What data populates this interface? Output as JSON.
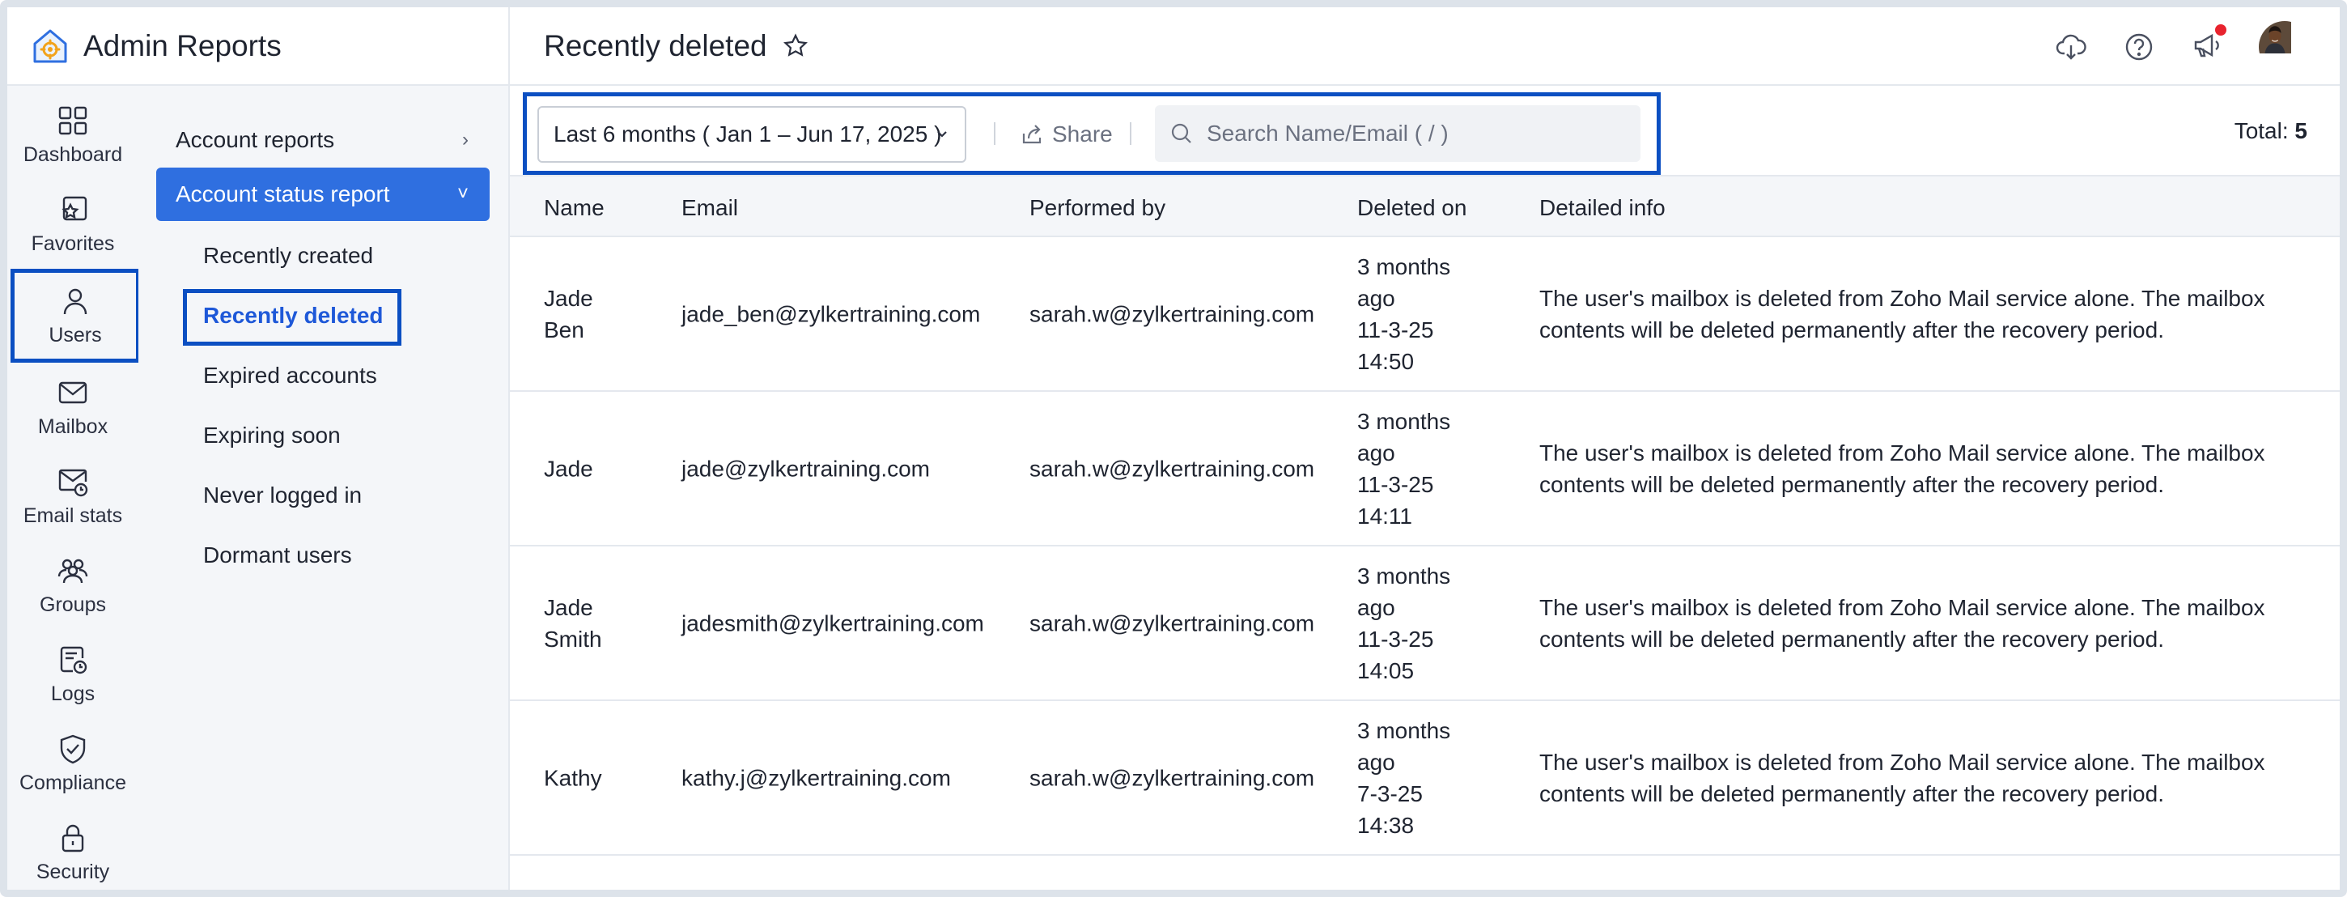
{
  "app": {
    "title": "Admin Reports"
  },
  "rail": {
    "items": [
      {
        "label": "Dashboard",
        "icon": "dashboard-icon"
      },
      {
        "label": "Favorites",
        "icon": "favorites-icon"
      },
      {
        "label": "Users",
        "icon": "user-icon",
        "active": true
      },
      {
        "label": "Mailbox",
        "icon": "mailbox-icon"
      },
      {
        "label": "Email stats",
        "icon": "email-stats-icon"
      },
      {
        "label": "Groups",
        "icon": "groups-icon"
      },
      {
        "label": "Logs",
        "icon": "logs-icon"
      },
      {
        "label": "Compliance",
        "icon": "compliance-icon"
      },
      {
        "label": "Security",
        "icon": "lock-icon"
      }
    ]
  },
  "submenu": {
    "account_reports": "Account reports",
    "account_status_report": "Account status report",
    "children": [
      "Recently created",
      "Recently deleted",
      "Expired accounts",
      "Expiring soon",
      "Never logged in",
      "Dormant users"
    ],
    "active_index": 1
  },
  "header": {
    "title": "Recently deleted"
  },
  "toolbar": {
    "date_range": "Last 6 months ( Jan 1 – Jun 17, 2025 )",
    "share_label": "Share",
    "search_placeholder": "Search Name/Email ( / )",
    "total_label": "Total:",
    "total_value": "5"
  },
  "table": {
    "columns": [
      "Name",
      "Email",
      "Performed by",
      "Deleted on",
      "Detailed info"
    ],
    "rows": [
      {
        "name": [
          "Jade",
          "Ben"
        ],
        "email": "jade_ben@zylkertraining.com",
        "performed_by": "sarah.w@zylkertraining.com",
        "deleted_on": [
          "3 months",
          "ago",
          "11-3-25",
          "14:50"
        ],
        "info": [
          "The user's mailbox is deleted from Zoho Mail service alone. The mailbox",
          "contents will be deleted permanently after the recovery period."
        ]
      },
      {
        "name": [
          "Jade"
        ],
        "email": "jade@zylkertraining.com",
        "performed_by": "sarah.w@zylkertraining.com",
        "deleted_on": [
          "3 months",
          "ago",
          "11-3-25",
          "14:11"
        ],
        "info": [
          "The user's mailbox is deleted from Zoho Mail service alone. The mailbox",
          "contents will be deleted permanently after the recovery period."
        ]
      },
      {
        "name": [
          "Jade",
          "Smith"
        ],
        "email": "jadesmith@zylkertraining.com",
        "performed_by": "sarah.w@zylkertraining.com",
        "deleted_on": [
          "3 months",
          "ago",
          "11-3-25",
          "14:05"
        ],
        "info": [
          "The user's mailbox is deleted from Zoho Mail service alone. The mailbox",
          "contents will be deleted permanently after the recovery period."
        ]
      },
      {
        "name": [
          "Kathy"
        ],
        "email": "kathy.j@zylkertraining.com",
        "performed_by": "sarah.w@zylkertraining.com",
        "deleted_on": [
          "3 months",
          "ago",
          "7-3-25",
          "14:38"
        ],
        "info": [
          "The user's mailbox is deleted from Zoho Mail service alone. The mailbox",
          "contents will be deleted permanently after the recovery period."
        ]
      }
    ]
  },
  "colors": {
    "accent": "#2f6fe0",
    "highlight_box": "#0b4fc2",
    "notification": "#e8232e",
    "sidebar_bg": "#f4f6f9"
  }
}
